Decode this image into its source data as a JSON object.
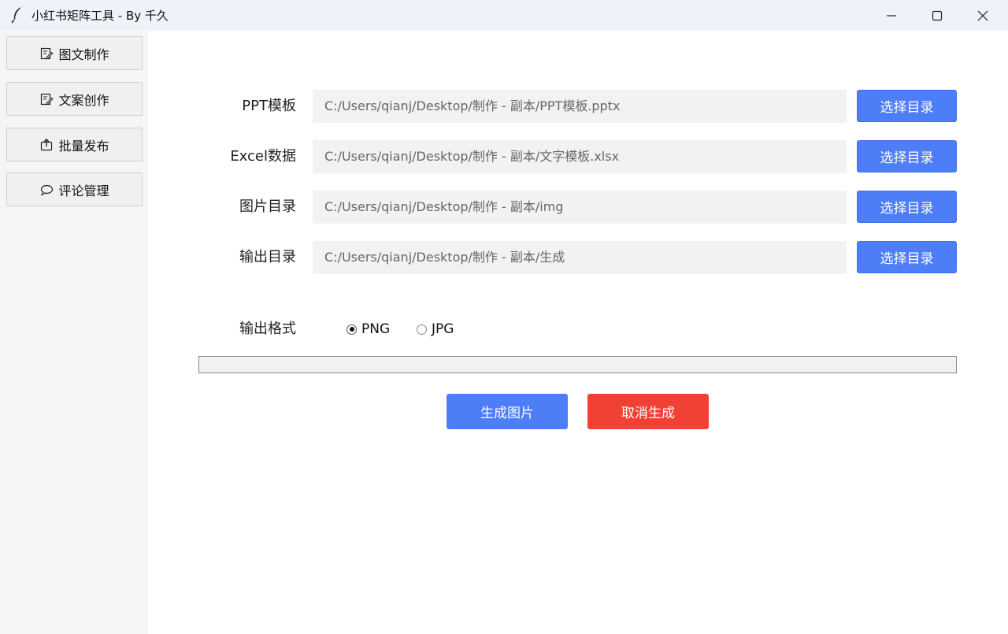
{
  "window": {
    "title": "小红书矩阵工具 - By 千久",
    "icon": "feather-icon",
    "controls": [
      "minimize-icon",
      "maximize-icon",
      "close-icon"
    ]
  },
  "sidebar": {
    "items": [
      {
        "label": "图文制作",
        "icon": "edit-doc-icon"
      },
      {
        "label": "文案创作",
        "icon": "edit-doc-icon"
      },
      {
        "label": "批量发布",
        "icon": "upload-icon"
      },
      {
        "label": "评论管理",
        "icon": "comment-bubble-icon"
      }
    ]
  },
  "form": {
    "rows": [
      {
        "label": "PPT模板",
        "value": "C:/Users/qianj/Desktop/制作 - 副本/PPT模板.pptx",
        "button": "选择目录"
      },
      {
        "label": "Excel数据",
        "value": "C:/Users/qianj/Desktop/制作 - 副本/文字模板.xlsx",
        "button": "选择目录"
      },
      {
        "label": "图片目录",
        "value": "C:/Users/qianj/Desktop/制作 - 副本/img",
        "button": "选择目录"
      },
      {
        "label": "输出目录",
        "value": "C:/Users/qianj/Desktop/制作 - 副本/生成",
        "button": "选择目录"
      }
    ],
    "format": {
      "label": "输出格式",
      "options": [
        "PNG",
        "JPG"
      ],
      "selected": "PNG"
    },
    "progress": 0
  },
  "actions": {
    "generate_label": "生成图片",
    "cancel_label": "取消生成"
  },
  "colors": {
    "primary": "#4d7ef7",
    "danger": "#f04134",
    "sidebar_bg": "#f5f5f5",
    "field_bg": "#f2f2f2",
    "titlebar_bg": "#eef2f9"
  }
}
